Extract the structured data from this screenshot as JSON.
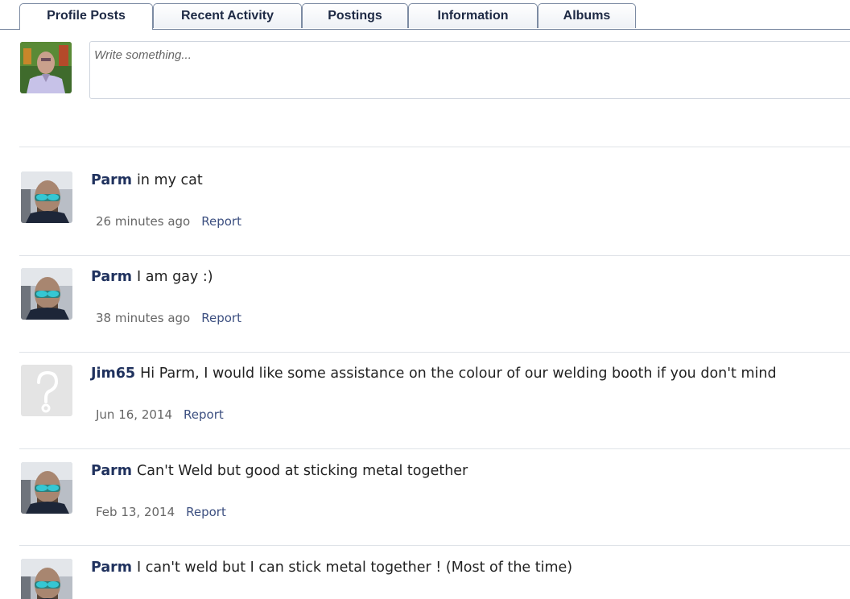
{
  "tabs": [
    {
      "label": "Profile Posts",
      "active": true
    },
    {
      "label": "Recent Activity",
      "active": false
    },
    {
      "label": "Postings",
      "active": false
    },
    {
      "label": "Information",
      "active": false
    },
    {
      "label": "Albums",
      "active": false
    }
  ],
  "composer": {
    "placeholder": "Write something..."
  },
  "posts": [
    {
      "author": "Parm",
      "message": "in my cat",
      "time": "26 minutes ago",
      "report": "Report"
    },
    {
      "author": "Parm",
      "message": "I am gay :)",
      "time": "38 minutes ago",
      "report": "Report"
    },
    {
      "author": "Jim65",
      "message": "Hi Parm, I would like some assistance on the colour of our welding booth if you don't mind",
      "time": "Jun 16, 2014",
      "report": "Report"
    },
    {
      "author": "Parm",
      "message": "Can't Weld but good at sticking metal together",
      "time": "Feb 13, 2014",
      "report": "Report"
    },
    {
      "author": "Parm",
      "message": "I can't weld but I can stick metal together ! (Most of the time)",
      "time": "",
      "report": ""
    }
  ],
  "colors": {
    "author_link": "#20325e",
    "report_link": "#3c4f80",
    "tab_border": "#7c8ba3"
  }
}
